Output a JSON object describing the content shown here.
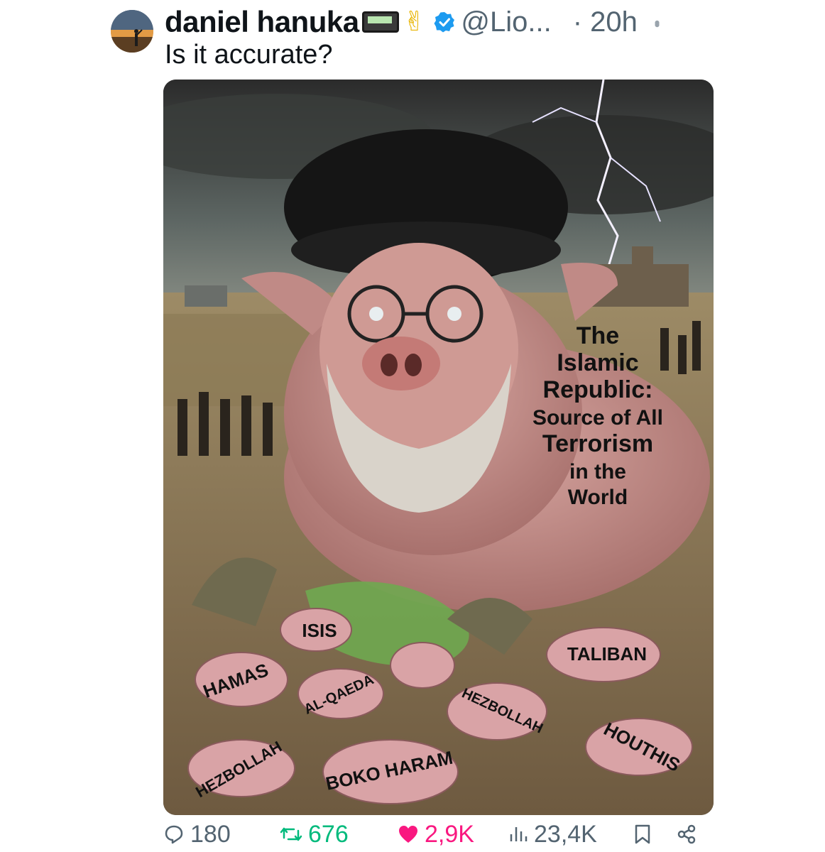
{
  "post": {
    "author_name": "daniel hanuka",
    "handle": "@Lio...",
    "time": "· 20h",
    "text": "Is it accurate?",
    "icons": [
      "pager-icon",
      "victory-hand-icon",
      "verified-badge-icon",
      "more-icon"
    ],
    "accent_color": "#1d9bf0"
  },
  "image": {
    "description_icon": "cartoon-image",
    "big_label_lines": [
      "The",
      "Islamic",
      "Republic:",
      "Source of All",
      "Terrorism",
      "in the",
      "World"
    ],
    "pig_labels": [
      "ISIS",
      "HAMAS",
      "AL-QAEDA",
      "TALIBAN",
      "HEZBOLLAH",
      "HEZBOLLAH",
      "BOKO HARAM",
      "HOUTHIS"
    ]
  },
  "actions": {
    "replies": "180",
    "reposts": "676",
    "likes": "2,9K",
    "views": "23,4K",
    "colors": {
      "muted": "#536471",
      "repost": "#00ba7c",
      "like": "#f91880"
    }
  }
}
